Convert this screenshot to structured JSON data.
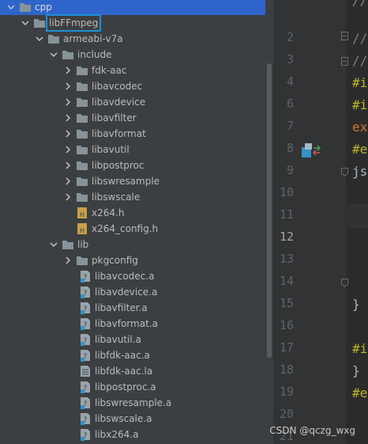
{
  "project_tree": {
    "root": "cpp",
    "selected": "libFFmpeg",
    "arch": "armeabi-v7a",
    "include": "include",
    "include_dirs": [
      "fdk-aac",
      "libavcodec",
      "libavdevice",
      "libavfilter",
      "libavformat",
      "libavutil",
      "libpostproc",
      "libswresample",
      "libswscale"
    ],
    "headers": [
      "x264.h",
      "x264_config.h"
    ],
    "lib": "lib",
    "pkgconfig": "pkgconfig",
    "libs": [
      "libavcodec.a",
      "libavdevice.a",
      "libavfilter.a",
      "libavformat.a",
      "libavutil.a",
      "libfdk-aac.a",
      "libfdk-aac.la",
      "libpostproc.a",
      "libswresample.a",
      "libswscale.a",
      "libx264.a"
    ]
  },
  "editor": {
    "line_numbers": [
      "",
      "2",
      "3",
      "4",
      "6",
      "7",
      "8",
      "9",
      "10",
      "11",
      "12",
      "13",
      "14",
      "15",
      "16",
      "17",
      "18",
      "19",
      "20",
      "21"
    ],
    "active_line": "12",
    "code_fragments": [
      "//",
      "//",
      "//",
      "#i",
      "#i",
      "ex",
      "#e",
      "js",
      "}",
      "#i",
      "}",
      "#e"
    ],
    "colors": {
      "comment": "#808080",
      "directive": "#bbb529",
      "keyword": "#cc7832",
      "plain": "#a9b7c6"
    }
  },
  "watermark": "CSDN @qczg_wxg"
}
